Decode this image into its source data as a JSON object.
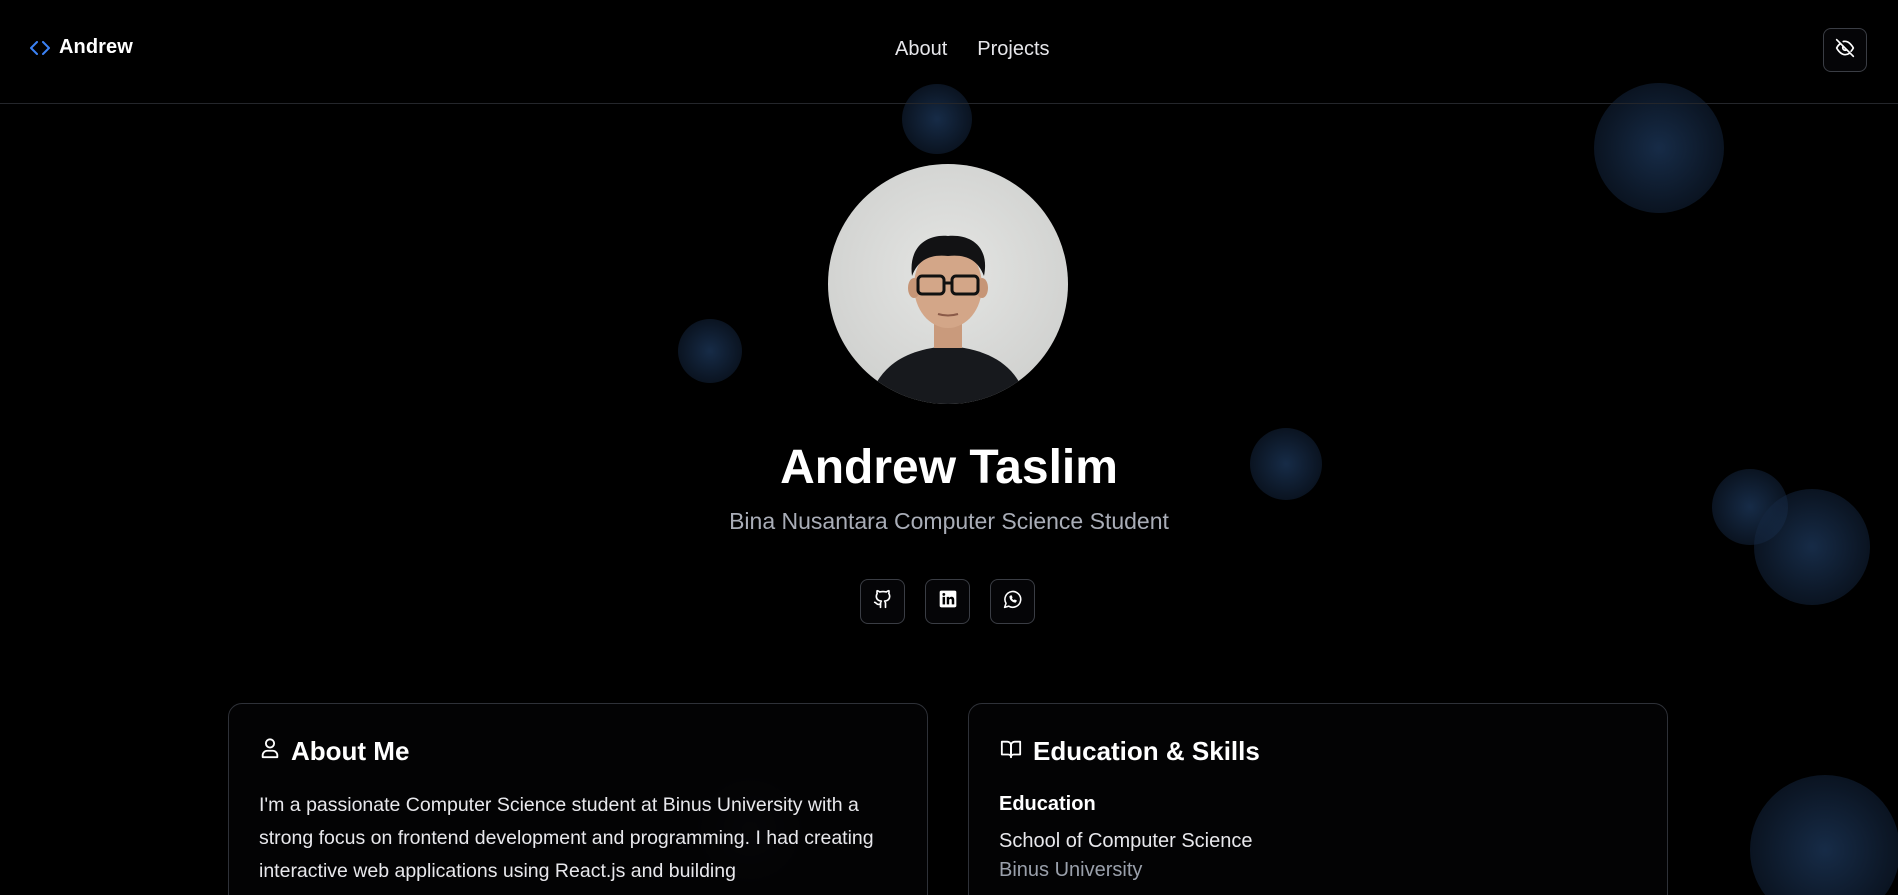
{
  "header": {
    "brand_symbol": "<>",
    "brand_name": "Andrew",
    "nav": [
      {
        "label": "About"
      },
      {
        "label": "Projects"
      }
    ],
    "toggle_icon": "eye-off-icon"
  },
  "hero": {
    "avatar_alt": "profile-photo",
    "name": "Andrew Taslim",
    "subtitle": "Bina Nusantara Computer Science Student",
    "socials": [
      {
        "icon": "github-icon"
      },
      {
        "icon": "linkedin-icon"
      },
      {
        "icon": "whatsapp-icon"
      }
    ]
  },
  "about": {
    "title": "About Me",
    "icon": "user-icon",
    "text": "I'm a passionate Computer Science student at Binus University with a strong focus on frontend development and programming. I had creating interactive web applications using React.js and building"
  },
  "education": {
    "title": "Education & Skills",
    "icon": "book-open-icon",
    "heading": "Education",
    "school": "School of Computer Science",
    "university": "Binus University"
  },
  "colors": {
    "background": "#000000",
    "accent": "#3b82f6",
    "bubble": "#1e3a5f",
    "muted_text": "#a9adb7"
  }
}
